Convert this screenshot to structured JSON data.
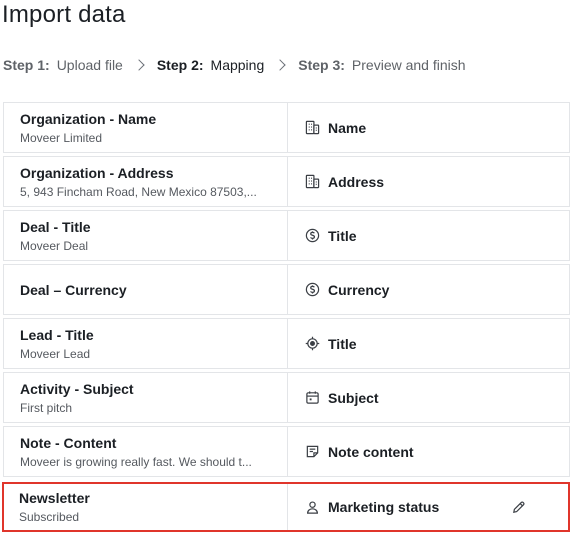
{
  "page": {
    "title": "Import data"
  },
  "steps": [
    {
      "num": "Step 1:",
      "label": "Upload file",
      "active": false
    },
    {
      "num": "Step 2:",
      "label": "Mapping",
      "active": true
    },
    {
      "num": "Step 3:",
      "label": "Preview and finish",
      "active": false
    }
  ],
  "rows": [
    {
      "field": "Organization - Name",
      "value": "Moveer Limited",
      "target": "Name",
      "icon": "building-icon"
    },
    {
      "field": "Organization - Address",
      "value": "5, 943 Fincham Road, New Mexico 87503,...",
      "target": "Address",
      "icon": "building-icon"
    },
    {
      "field": "Deal - Title",
      "value": "Moveer Deal",
      "target": "Title",
      "icon": "dollar-coin-icon"
    },
    {
      "field": "Deal – Currency",
      "value": "",
      "target": "Currency",
      "icon": "dollar-coin-icon"
    },
    {
      "field": "Lead - Title",
      "value": "Moveer Lead",
      "target": "Title",
      "icon": "target-icon"
    },
    {
      "field": "Activity - Subject",
      "value": "First pitch",
      "target": "Subject",
      "icon": "calendar-icon"
    },
    {
      "field": "Note - Content",
      "value": "Moveer is growing really fast. We should t...",
      "target": "Note content",
      "icon": "note-icon"
    },
    {
      "field": "Newsletter",
      "value": "Subscribed",
      "target": "Marketing status",
      "icon": "person-icon",
      "highlighted": true,
      "editable": true
    }
  ],
  "colors": {
    "highlight_border": "#e0352b",
    "row_border": "#e3e5e8"
  }
}
